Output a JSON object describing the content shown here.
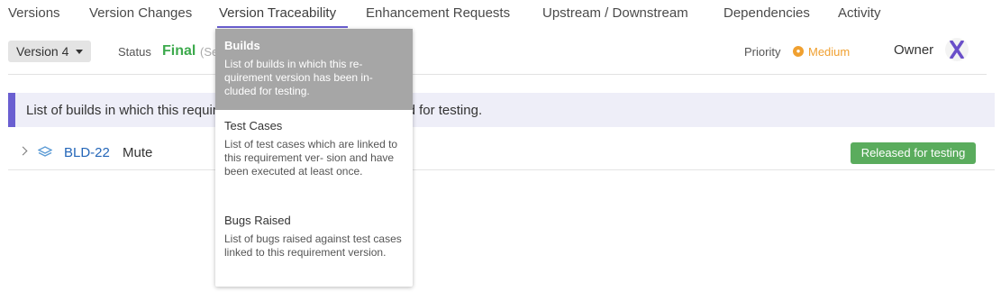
{
  "tabs": [
    {
      "label": "Versions"
    },
    {
      "label": "Version Changes"
    },
    {
      "label": "Version Traceability"
    },
    {
      "label": "Enhancement Requests"
    },
    {
      "label": "Upstream / Downstream"
    },
    {
      "label": "Dependencies"
    },
    {
      "label": "Activity"
    }
  ],
  "active_tab": "Version Traceability",
  "toolbar": {
    "version_select": "Version 4",
    "status_label": "Status",
    "status_value": "Final",
    "status_extra": "(Se",
    "priority_label": "Priority",
    "priority_value": "Medium",
    "owner_label": "Owner"
  },
  "banner": {
    "text": "List of builds in which this requirement version has been included for testing."
  },
  "builds": [
    {
      "id": "BLD-22",
      "name": "Mute",
      "status": "Released for testing"
    }
  ],
  "dropdown": {
    "items": [
      {
        "title": "Builds",
        "description": "List of builds in which this re- quirement version has been in- cluded for testing."
      },
      {
        "title": "Test Cases",
        "description": "List of test cases which are linked to this requirement ver- sion and have been executed at least once."
      },
      {
        "title": "Bugs Raised",
        "description": "List of bugs raised against test cases linked to this requirement version."
      }
    ]
  },
  "colors": {
    "accent": "#6a5fd1",
    "status_final": "#3daa4d",
    "priority_medium": "#f0a030",
    "link": "#2466b8",
    "badge_released": "#5aac5d",
    "banner_bg": "#eeeef8",
    "dropdown_selected": "#a6a6a6"
  },
  "icons": {
    "version_caret": "caret-down-icon",
    "priority": "medium-priority-icon",
    "owner": "owner-avatar-x-icon",
    "row_expand": "chevron-right-icon",
    "build": "build-layers-icon"
  }
}
